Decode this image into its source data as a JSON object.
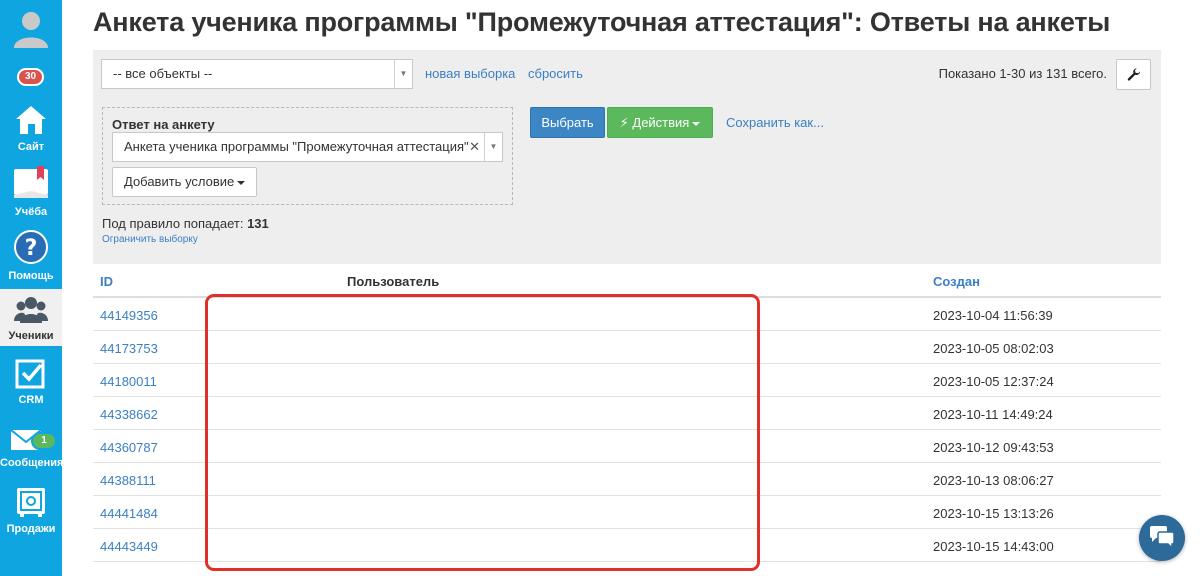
{
  "page": {
    "title": "Анкета ученика программы \"Промежуточная аттестация\": Ответы на анкеты"
  },
  "sidebar": {
    "badge_count": "30",
    "items": [
      {
        "label": "Сайт",
        "icon": "home-icon"
      },
      {
        "label": "Учёба",
        "icon": "book-icon"
      },
      {
        "label": "Помощь",
        "icon": "help-icon"
      },
      {
        "label": "Ученики",
        "icon": "users-icon"
      },
      {
        "label": "CRM",
        "icon": "checkbox-icon"
      },
      {
        "label": "Сообщения",
        "icon": "envelope-icon",
        "badge": "1"
      },
      {
        "label": "Продажи",
        "icon": "safe-icon"
      }
    ]
  },
  "filter": {
    "objects_select": "-- все объекты --",
    "new_selection": "новая выборка",
    "reset": "сбросить",
    "shown": "Показано 1-30 из 131 всего.",
    "condition_title": "Ответ на анкету",
    "condition_value": "Анкета ученика программы \"Промежуточная аттестация\"",
    "add_condition": "Добавить условие",
    "select_btn": "Выбрать",
    "actions_btn": "Действия",
    "save_as": "Сохранить как...",
    "rule_label": "Под правило попадает:",
    "rule_count": "131",
    "limit": "Ограничить выборку"
  },
  "table": {
    "headers": {
      "id": "ID",
      "user": "Пользователь",
      "created": "Создан"
    },
    "rows": [
      {
        "id": "44149356",
        "created": "2023-10-04 11:56:39"
      },
      {
        "id": "44173753",
        "created": "2023-10-05 08:02:03"
      },
      {
        "id": "44180011",
        "created": "2023-10-05 12:37:24"
      },
      {
        "id": "44338662",
        "created": "2023-10-11 14:49:24"
      },
      {
        "id": "44360787",
        "created": "2023-10-12 09:43:53"
      },
      {
        "id": "44388111",
        "created": "2023-10-13 08:06:27"
      },
      {
        "id": "44441484",
        "created": "2023-10-15 13:13:26"
      },
      {
        "id": "44443449",
        "created": "2023-10-15 14:43:00"
      }
    ]
  },
  "colors": {
    "sidebar": "#0fa5e0",
    "link": "#3b7fc4",
    "primary": "#3c86c6",
    "success": "#5cb85c",
    "redaction": "#e0302a"
  }
}
